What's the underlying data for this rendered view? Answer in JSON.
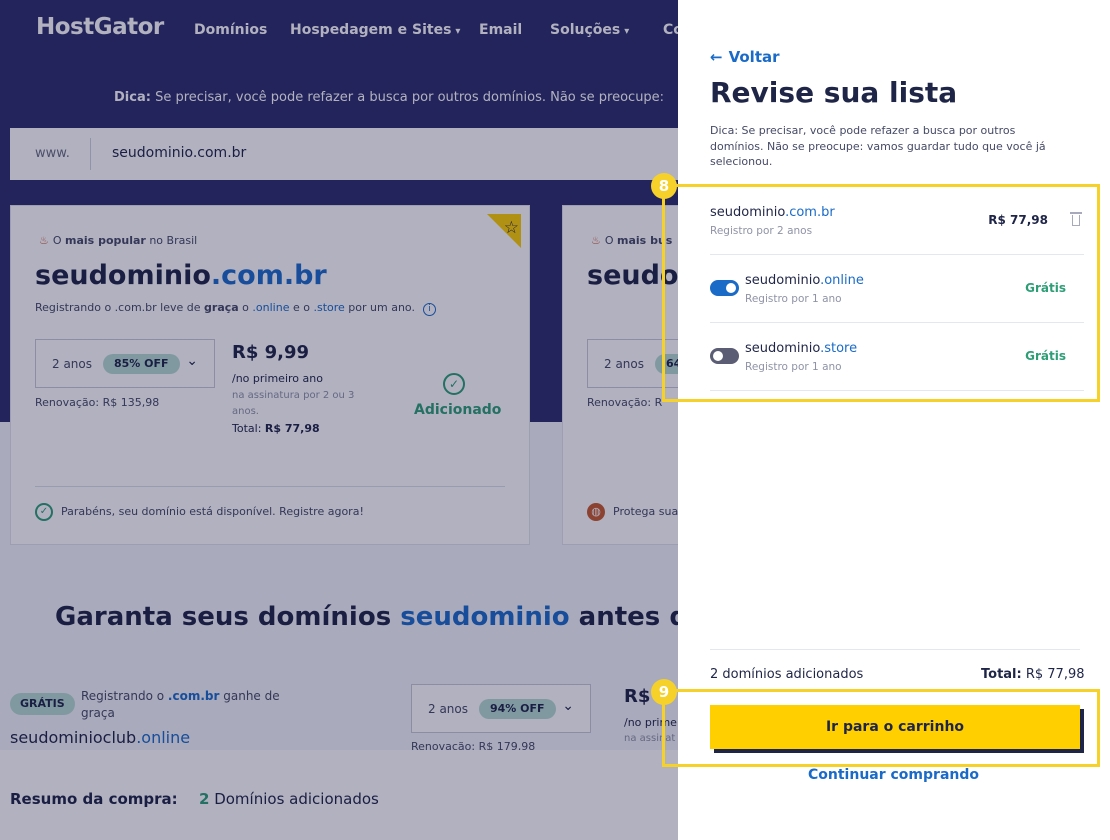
{
  "nav": {
    "logo": "HostGator",
    "items": [
      "Domínios",
      "Hospedagem e Sites",
      "Email",
      "Soluções",
      "Co"
    ],
    "chevron": "⌄"
  },
  "hero": {
    "tip_bold": "Dica:",
    "tip_text": " Se precisar, você pode refazer a busca por outros domínios. Não se preocupe:",
    "search_prefix": "www.",
    "search_value": "seudominio.com.br"
  },
  "card1": {
    "popular_pre": "O ",
    "popular_bold": "mais popular",
    "popular_post": " no Brasil",
    "name": "seudominio",
    "tld": ".com.br",
    "desc_pre": "Registrando o .com.br leve de ",
    "desc_bold": "graça",
    "desc_mid1": " o ",
    "desc_tld1": ".online",
    "desc_mid2": " e o ",
    "desc_tld2": ".store",
    "desc_post": " por um ano.",
    "years": "2 anos",
    "off": "85% OFF",
    "renewal": "Renovação: R$ 135,98",
    "price": "R$ 9,99",
    "price_sub": "/no primeiro ano",
    "price_note": "na assinatura por 2 ou 3 anos.",
    "total_label": "Total: ",
    "total_value": "R$ 77,98",
    "added": "Adicionado",
    "footer": "Parabéns, seu domínio está disponível. Registre agora!"
  },
  "card2": {
    "popular_pre": "O ",
    "popular_bold": "mais bus",
    "name": "seudom",
    "years": "2 anos",
    "off": "64",
    "renewal": "Renovação: R",
    "footer": "Protega sua"
  },
  "section": {
    "title_pre": "Garanta seus domínios ",
    "title_blue": "seudominio",
    "title_post": " antes q",
    "gratis": "GRÁTIS",
    "gratis_pre": "Registrando o ",
    "gratis_tld": ".com.br",
    "gratis_post": " ganhe de graça",
    "club_name": "seudominioclub",
    "club_tld": ".online",
    "years": "2 anos",
    "off": "94% OFF",
    "renewal": "Renovação: R$ 179,98",
    "price": "R$",
    "price_sub": "/no primei",
    "price_note": "na assinat"
  },
  "summary": {
    "label": "Resumo da compra:",
    "count": "2",
    "count_text": " Domínios adicionados"
  },
  "drawer": {
    "back": "Voltar",
    "title": "Revise sua lista",
    "tip": "Dica: Se precisar, você pode refazer a busca por outros domínios. Não se preocupe: vamos guardar tudo que você já selecionou.",
    "items": [
      {
        "name": "seudominio",
        "tld": ".com.br",
        "sub": "Registro por 2 anos",
        "price": "R$ 77,98"
      },
      {
        "name": "seudominio",
        "tld": ".online",
        "sub": "Registro por 1 ano",
        "price": "Grátis",
        "enabled": true
      },
      {
        "name": "seudominio",
        "tld": ".store",
        "sub": "Registro por 1 ano",
        "price": "Grátis",
        "enabled": false
      }
    ],
    "count_text": "2 domínios adicionados",
    "total_label": "Total:",
    "total_value": " R$ 77,98",
    "cart_button": "Ir para o carrinho",
    "continue": "Continuar comprando"
  },
  "annotations": {
    "step8": "8",
    "step9": "9"
  },
  "colors": {
    "navy": "#2b2d6a",
    "blue": "#1a6bc8",
    "green": "#2e9e77",
    "yellow": "#ffcf00",
    "highlight": "#f5d12a"
  }
}
